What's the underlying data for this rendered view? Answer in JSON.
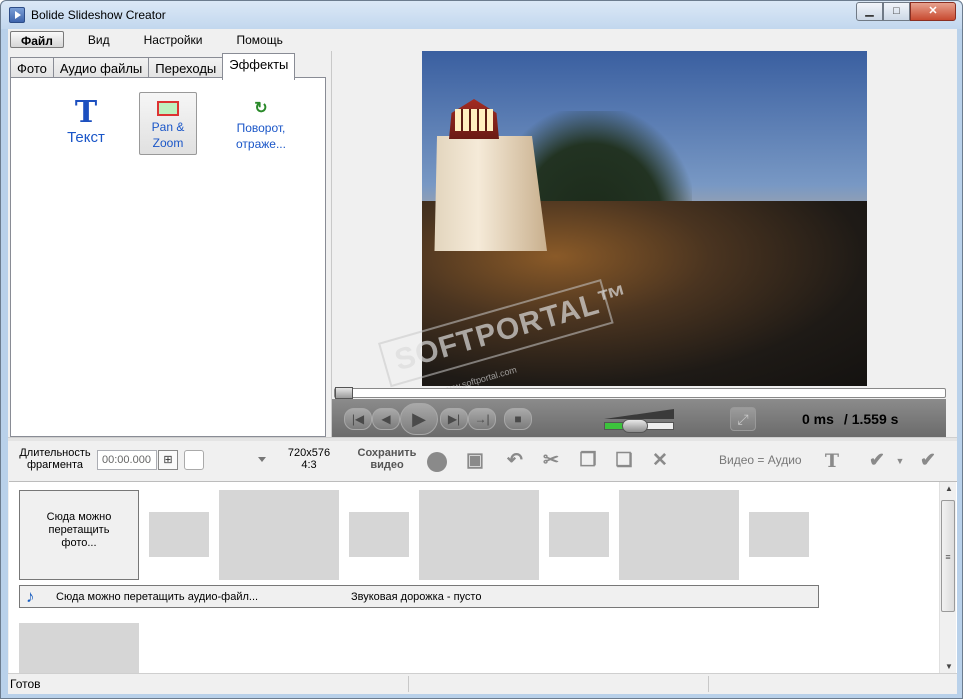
{
  "window": {
    "title": "Bolide Slideshow Creator",
    "min": "▁",
    "max": "□",
    "close": "✕"
  },
  "menu": [
    "Файл",
    "Вид",
    "Настройки",
    "Помощь"
  ],
  "tabs": [
    "Фото",
    "Аудио файлы",
    "Переходы",
    "Эффекты"
  ],
  "effects": {
    "text_glyph": "T",
    "text_label": "Текст",
    "pan_line1": "Pan &",
    "pan_line2": "Zoom",
    "rotate_glyph": "↻",
    "rotate_line1": "Поворот,",
    "rotate_line2": "отраже..."
  },
  "preview": {
    "watermark": "SOFTPORTAL™",
    "watermark_url": "www.softportal.com",
    "current_time": "0 ms",
    "total_time": "/ 1.559 s",
    "volume_level": 0.3
  },
  "toolbar": {
    "duration_label_1": "Длительность",
    "duration_label_2": "фрагмента",
    "duration_value": "00:00.000",
    "resolution": "720x576",
    "aspect": "4:3",
    "save_line1": "Сохранить",
    "save_line2": "видео",
    "video_audio": "Видео = Аудио"
  },
  "timeline": {
    "photo_drop_line1": "Сюда можно",
    "photo_drop_line2": "перетащить",
    "photo_drop_line3": "фото...",
    "audio_drop": "Сюда можно перетащить аудио-файл...",
    "audio_status": "Звуковая дорожка - пусто"
  },
  "status": {
    "text": "Готов"
  }
}
